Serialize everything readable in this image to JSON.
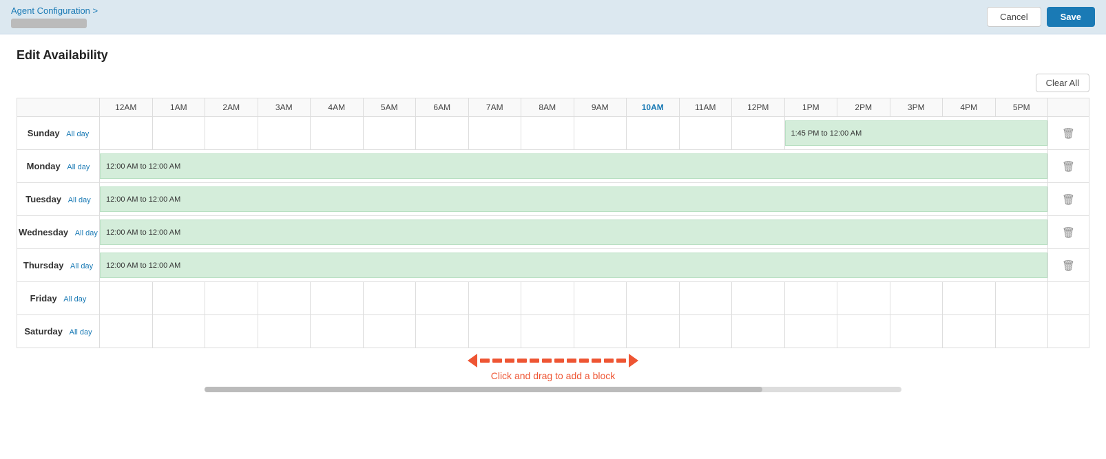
{
  "header": {
    "breadcrumb": "Agent Configuration >",
    "cancel_label": "Cancel",
    "save_label": "Save"
  },
  "page": {
    "title": "Edit Availability",
    "clear_all_label": "Clear All"
  },
  "time_headers": [
    "12AM",
    "1AM",
    "2AM",
    "3AM",
    "4AM",
    "5AM",
    "6AM",
    "7AM",
    "8AM",
    "9AM",
    "10AM",
    "11AM",
    "12PM",
    "1PM",
    "2PM",
    "3PM",
    "4PM",
    "5PM"
  ],
  "days": [
    {
      "name": "Sunday",
      "all_day": "All day",
      "block": "1:45 PM to 12:00 AM",
      "has_block": true,
      "full_block": false
    },
    {
      "name": "Monday",
      "all_day": "All day",
      "block": "12:00 AM to 12:00 AM",
      "has_block": true,
      "full_block": true
    },
    {
      "name": "Tuesday",
      "all_day": "All day",
      "block": "12:00 AM to 12:00 AM",
      "has_block": true,
      "full_block": true
    },
    {
      "name": "Wednesday",
      "all_day": "All day",
      "block": "12:00 AM to 12:00 AM",
      "has_block": true,
      "full_block": true
    },
    {
      "name": "Thursday",
      "all_day": "All day",
      "block": "12:00 AM to 12:00 AM",
      "has_block": true,
      "full_block": true
    },
    {
      "name": "Friday",
      "all_day": "All day",
      "block": "",
      "has_block": false,
      "full_block": false
    },
    {
      "name": "Saturday",
      "all_day": "All day",
      "block": "",
      "has_block": false,
      "full_block": false
    }
  ],
  "drag_hint": "Click and drag to add a block",
  "colors": {
    "accent": "#1a7ab5",
    "block_bg": "#d4edda",
    "block_border": "#b8dfc2",
    "arrow_red": "#e53935"
  }
}
